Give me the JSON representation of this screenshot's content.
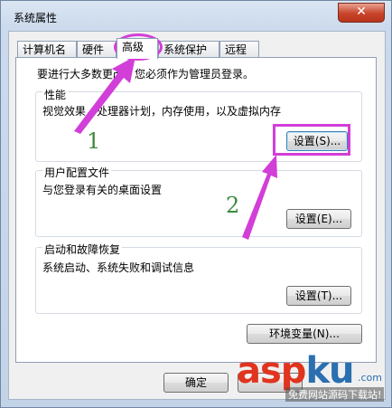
{
  "window": {
    "title": "系统属性",
    "close_label": "✕"
  },
  "tabs": [
    {
      "label": "计算机名"
    },
    {
      "label": "硬件"
    },
    {
      "label": "高级"
    },
    {
      "label": "系统保护"
    },
    {
      "label": "远程"
    }
  ],
  "notice": "要进行大多数更改，您必须作为管理员登录。",
  "performance": {
    "title": "性能",
    "desc": "视觉效果，处理器计划，内存使用，以及虚拟内存",
    "button": "设置(S)..."
  },
  "profiles": {
    "title": "用户配置文件",
    "desc": "与您登录有关的桌面设置",
    "button": "设置(E)..."
  },
  "startup": {
    "title": "启动和故障恢复",
    "desc": "系统启动、系统失败和调试信息",
    "button": "设置(T)..."
  },
  "env_button": "环境变量(N)...",
  "footer": {
    "ok": "确定"
  },
  "annotations": {
    "step1": "1",
    "step2": "2",
    "accent": "#d23ed8"
  },
  "watermark": {
    "main_a": "asp",
    "main_b": "ku",
    "com": ".com",
    "sub": "免费网站源码下载站!"
  }
}
